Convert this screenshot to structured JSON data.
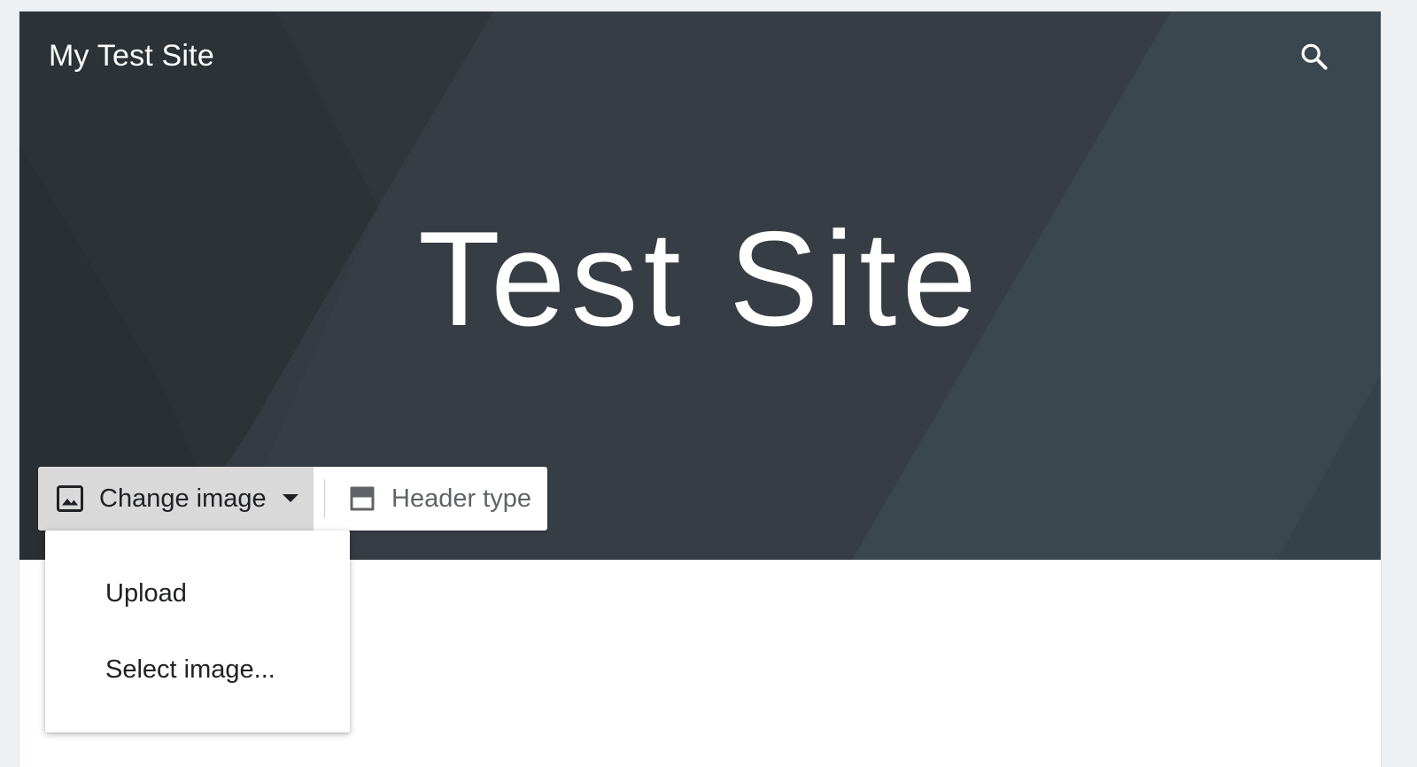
{
  "header": {
    "site_name": "My Test Site",
    "search_icon": "search-icon"
  },
  "hero": {
    "title": "Test Site",
    "background_color": "#343b42"
  },
  "toolbar": {
    "change_image_label": "Change image",
    "change_image_icon": "image-icon",
    "header_type_label": "Header type",
    "header_type_icon": "header-layout-icon"
  },
  "change_image_menu": {
    "items": [
      {
        "label": "Upload"
      },
      {
        "label": "Select image..."
      }
    ]
  }
}
